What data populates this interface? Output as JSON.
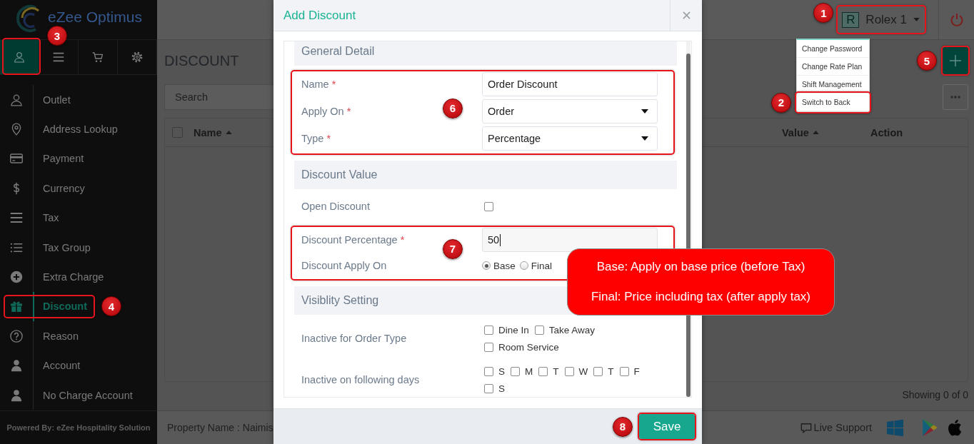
{
  "sidebar": {
    "logo_text": "eZee Optimus",
    "tabs": [
      {
        "selected": true,
        "annotation": "3"
      },
      {
        "selected": false
      },
      {
        "selected": false
      },
      {
        "selected": false
      }
    ],
    "items": [
      {
        "label": "Outlet",
        "selected": false
      },
      {
        "label": "Address Lookup",
        "selected": false
      },
      {
        "label": "Payment",
        "selected": false
      },
      {
        "label": "Currency",
        "selected": false
      },
      {
        "label": "Tax",
        "selected": false
      },
      {
        "label": "Tax Group",
        "selected": false
      },
      {
        "label": "Extra Charge",
        "selected": false
      },
      {
        "label": "Discount",
        "selected": true,
        "annotation": "4"
      },
      {
        "label": "Reason",
        "selected": false
      },
      {
        "label": "Account",
        "selected": false
      },
      {
        "label": "No Charge Account",
        "selected": false
      }
    ],
    "footer": "Powered By: eZee Hospitality Solution"
  },
  "header": {
    "user": {
      "initial": "R",
      "name": "Rolex 1",
      "annotation": "1"
    },
    "user_menu": [
      {
        "label": "Change Password"
      },
      {
        "label": "Change Rate Plan"
      },
      {
        "label": "Shift Management"
      },
      {
        "label": "Switch to Back",
        "annotation": "2"
      }
    ]
  },
  "page": {
    "title": "DISCOUNT",
    "add_button": {
      "annotation": "5"
    },
    "search": {
      "placeholder": "Search"
    },
    "table": {
      "select_all": {
        "checked": false
      },
      "columns": [
        {
          "label": "Name",
          "sorted": true
        },
        {
          "label": "Value",
          "sorted": true
        },
        {
          "label": "Action",
          "sorted": false
        }
      ]
    },
    "pager": "Showing 0 of 0"
  },
  "status_bar": {
    "property": "Property Name : Naimis",
    "live_support": "Live Support"
  },
  "modal": {
    "title": "Add Discount",
    "sections": [
      {
        "title": "General Detail",
        "groups": [
          {
            "annotation": "6",
            "fields": [
              {
                "kind": "text",
                "label": "Name",
                "required_mark": "*",
                "value": "Order Discount",
                "focused": false
              },
              {
                "kind": "select",
                "label": "Apply On",
                "required_mark": "*",
                "value": "Order"
              },
              {
                "kind": "select",
                "label": "Type",
                "required_mark": "*",
                "value": "Percentage"
              }
            ]
          }
        ]
      },
      {
        "title": "Discount Value",
        "groups": [
          {
            "fields": [
              {
                "kind": "checkbox",
                "label": "Open Discount",
                "checked": false
              }
            ]
          },
          {
            "annotation": "7",
            "fields": [
              {
                "kind": "text",
                "label": "Discount Percentage",
                "required_mark": "*",
                "value": "50",
                "focused": true
              },
              {
                "kind": "radio",
                "label": "Discount Apply On",
                "options": [
                  {
                    "label": "Base",
                    "selected": true
                  },
                  {
                    "label": "Final",
                    "selected": false
                  }
                ]
              }
            ]
          }
        ]
      },
      {
        "title": "Visiblity Setting",
        "groups": [
          {
            "fields": [
              {
                "kind": "checkbox_list",
                "label": "Inactive for Order Type",
                "options": [
                  {
                    "label": "Dine In",
                    "checked": false
                  },
                  {
                    "label": "Take Away",
                    "checked": false
                  },
                  {
                    "label": "Room Service",
                    "checked": false
                  }
                ]
              },
              {
                "kind": "checkbox_list",
                "label": "Inactive on following days",
                "options": [
                  {
                    "label": "S",
                    "checked": false
                  },
                  {
                    "label": "M",
                    "checked": false
                  },
                  {
                    "label": "T",
                    "checked": false
                  },
                  {
                    "label": "W",
                    "checked": false
                  },
                  {
                    "label": "T",
                    "checked": false
                  },
                  {
                    "label": "F",
                    "checked": false
                  },
                  {
                    "label": "S",
                    "checked": false
                  }
                ]
              }
            ]
          }
        ]
      }
    ],
    "save": {
      "label": "Save",
      "annotation": "8"
    }
  },
  "callout": {
    "lines": [
      "Base: Apply on base price (before Tax)",
      "Final: Price including tax (after apply tax)"
    ]
  }
}
